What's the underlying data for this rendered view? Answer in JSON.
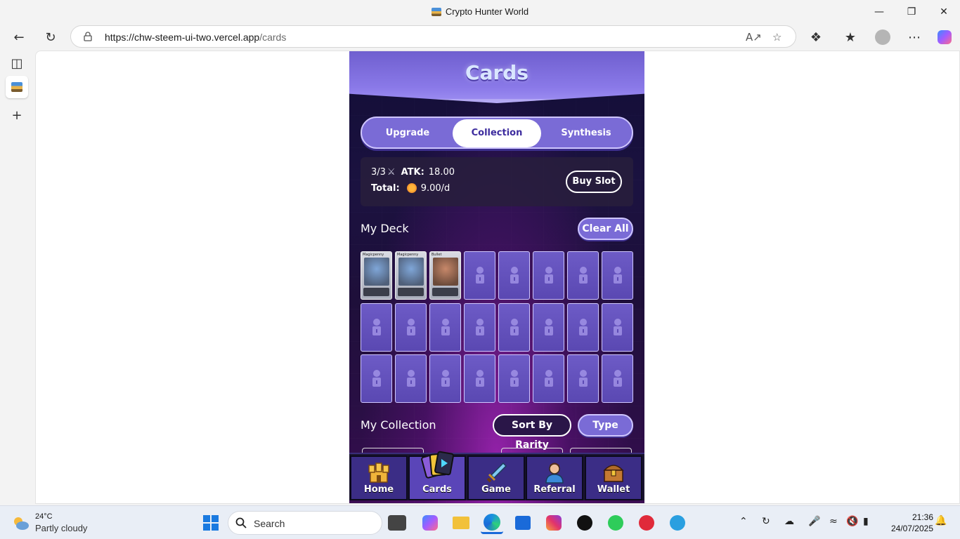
{
  "window": {
    "title": "Crypto Hunter World"
  },
  "browser": {
    "url_host": "https://chw-steem-ui-two.vercel.app",
    "url_path": "/cards"
  },
  "page": {
    "header_title": "Cards",
    "tabs": [
      {
        "label": "Upgrade",
        "active": false
      },
      {
        "label": "Collection",
        "active": true
      },
      {
        "label": "Synthesis",
        "active": false
      }
    ],
    "stats": {
      "slots": "3/3",
      "atk_label": "ATK:",
      "atk_value": "18.00",
      "total_label": "Total:",
      "total_value": "9.00/d",
      "buy_slot_label": "Buy Slot"
    },
    "deck": {
      "title": "My Deck",
      "clear_all_label": "Clear All",
      "cards": [
        {
          "name": "Magicpenny"
        },
        {
          "name": "Magicpenny"
        },
        {
          "name": "Bullet"
        }
      ],
      "locked_slots_count": 21
    },
    "collection": {
      "title": "My Collection",
      "sort_label": "Sort By Rarity",
      "type_label": "Type"
    },
    "bottom_nav": [
      {
        "label": "Home",
        "icon": "castle-icon",
        "active": false
      },
      {
        "label": "Cards",
        "icon": "cards-icon",
        "active": true
      },
      {
        "label": "Game",
        "icon": "sword-icon",
        "active": false
      },
      {
        "label": "Referral",
        "icon": "person-icon",
        "active": false
      },
      {
        "label": "Wallet",
        "icon": "chest-icon",
        "active": false
      }
    ]
  },
  "taskbar": {
    "weather_temp": "24°C",
    "weather_condition": "Partly cloudy",
    "search_label": "Search",
    "time": "21:36",
    "date": "24/07/2025"
  },
  "colors": {
    "accent_purple": "#7a6bd6",
    "game_bg": "#1b1240",
    "active_tab_text": "#3d2c9e"
  }
}
